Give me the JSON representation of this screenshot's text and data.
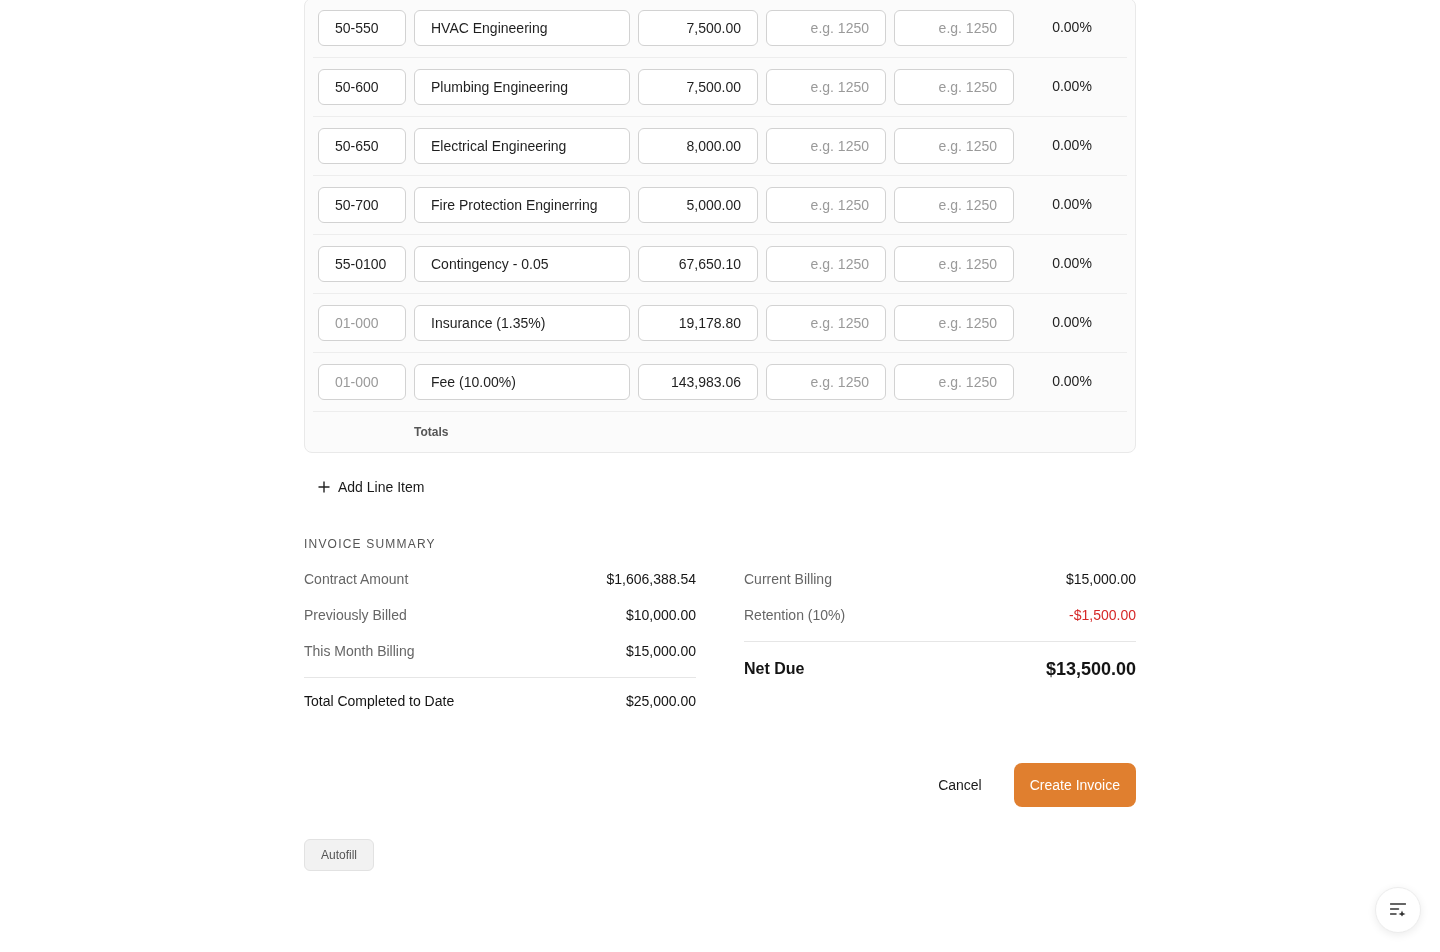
{
  "line_items": [
    {
      "code": {
        "value": "50-550"
      },
      "description": {
        "value": "HVAC Engineering"
      },
      "amount": {
        "value": "7,500.00"
      },
      "column_4": {
        "placeholder": "e.g. 1250"
      },
      "column_5": {
        "placeholder": "e.g. 1250"
      },
      "percent": "0.00%"
    },
    {
      "code": {
        "value": "50-600"
      },
      "description": {
        "value": "Plumbing Engineering"
      },
      "amount": {
        "value": "7,500.00"
      },
      "column_4": {
        "placeholder": "e.g. 1250"
      },
      "column_5": {
        "placeholder": "e.g. 1250"
      },
      "percent": "0.00%"
    },
    {
      "code": {
        "value": "50-650"
      },
      "description": {
        "value": "Electrical Engineering"
      },
      "amount": {
        "value": "8,000.00"
      },
      "column_4": {
        "placeholder": "e.g. 1250"
      },
      "column_5": {
        "placeholder": "e.g. 1250"
      },
      "percent": "0.00%"
    },
    {
      "code": {
        "value": "50-700"
      },
      "description": {
        "value": "Fire Protection Enginerring"
      },
      "amount": {
        "value": "5,000.00"
      },
      "column_4": {
        "placeholder": "e.g. 1250"
      },
      "column_5": {
        "placeholder": "e.g. 1250"
      },
      "percent": "0.00%"
    },
    {
      "code": {
        "value": "55-0100"
      },
      "description": {
        "value": "Contingency - 0.05"
      },
      "amount": {
        "value": "67,650.10"
      },
      "column_4": {
        "placeholder": "e.g. 1250"
      },
      "column_5": {
        "placeholder": "e.g. 1250"
      },
      "percent": "0.00%"
    },
    {
      "code": {
        "placeholder": "01-000"
      },
      "description": {
        "value": "Insurance (1.35%)"
      },
      "amount": {
        "value": "19,178.80"
      },
      "column_4": {
        "placeholder": "e.g. 1250"
      },
      "column_5": {
        "placeholder": "e.g. 1250"
      },
      "percent": "0.00%"
    },
    {
      "code": {
        "placeholder": "01-000"
      },
      "description": {
        "value": "Fee (10.00%)"
      },
      "amount": {
        "value": "143,983.06"
      },
      "column_4": {
        "placeholder": "e.g. 1250"
      },
      "column_5": {
        "placeholder": "e.g. 1250"
      },
      "percent": "0.00%"
    }
  ],
  "totals_row": {
    "label": "Totals"
  },
  "add_line_item": {
    "label": "Add Line Item"
  },
  "invoice_summary": {
    "title": "INVOICE SUMMARY",
    "left": {
      "rows": [
        {
          "label": "Contract Amount",
          "value": "$1,606,388.54"
        },
        {
          "label": "Previously Billed",
          "value": "$10,000.00"
        },
        {
          "label": "This Month Billing",
          "value": "$15,000.00"
        }
      ],
      "total": {
        "label": "Total Completed to Date",
        "value": "$25,000.00"
      }
    },
    "right": {
      "rows": [
        {
          "label": "Current Billing",
          "value": "$15,000.00",
          "kind": "normal"
        },
        {
          "label": "Retention (10%)",
          "value": "-$1,500.00",
          "kind": "deduction"
        }
      ],
      "total": {
        "label": "Net Due",
        "value": "$13,500.00"
      }
    }
  },
  "actions": [
    {
      "label": "Cancel",
      "kind": "secondary"
    },
    {
      "label": "Create Invoice",
      "kind": "primary"
    }
  ],
  "autofill_button": {
    "label": "Autofill"
  }
}
